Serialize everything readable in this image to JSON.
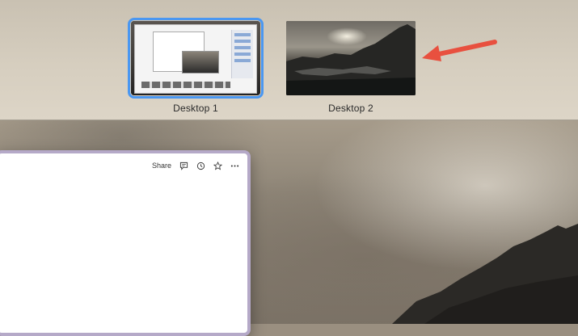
{
  "spaces": [
    {
      "label": "Desktop 1",
      "selected": true
    },
    {
      "label": "Desktop 2",
      "selected": false
    }
  ],
  "window": {
    "toolbar": {
      "share_label": "Share",
      "icons": [
        "comment-icon",
        "history-icon",
        "star-icon",
        "more-icon"
      ]
    }
  },
  "colors": {
    "selection": "#4a97f1",
    "arrow": "#e8503f",
    "window_border": "#b5a9c8"
  }
}
